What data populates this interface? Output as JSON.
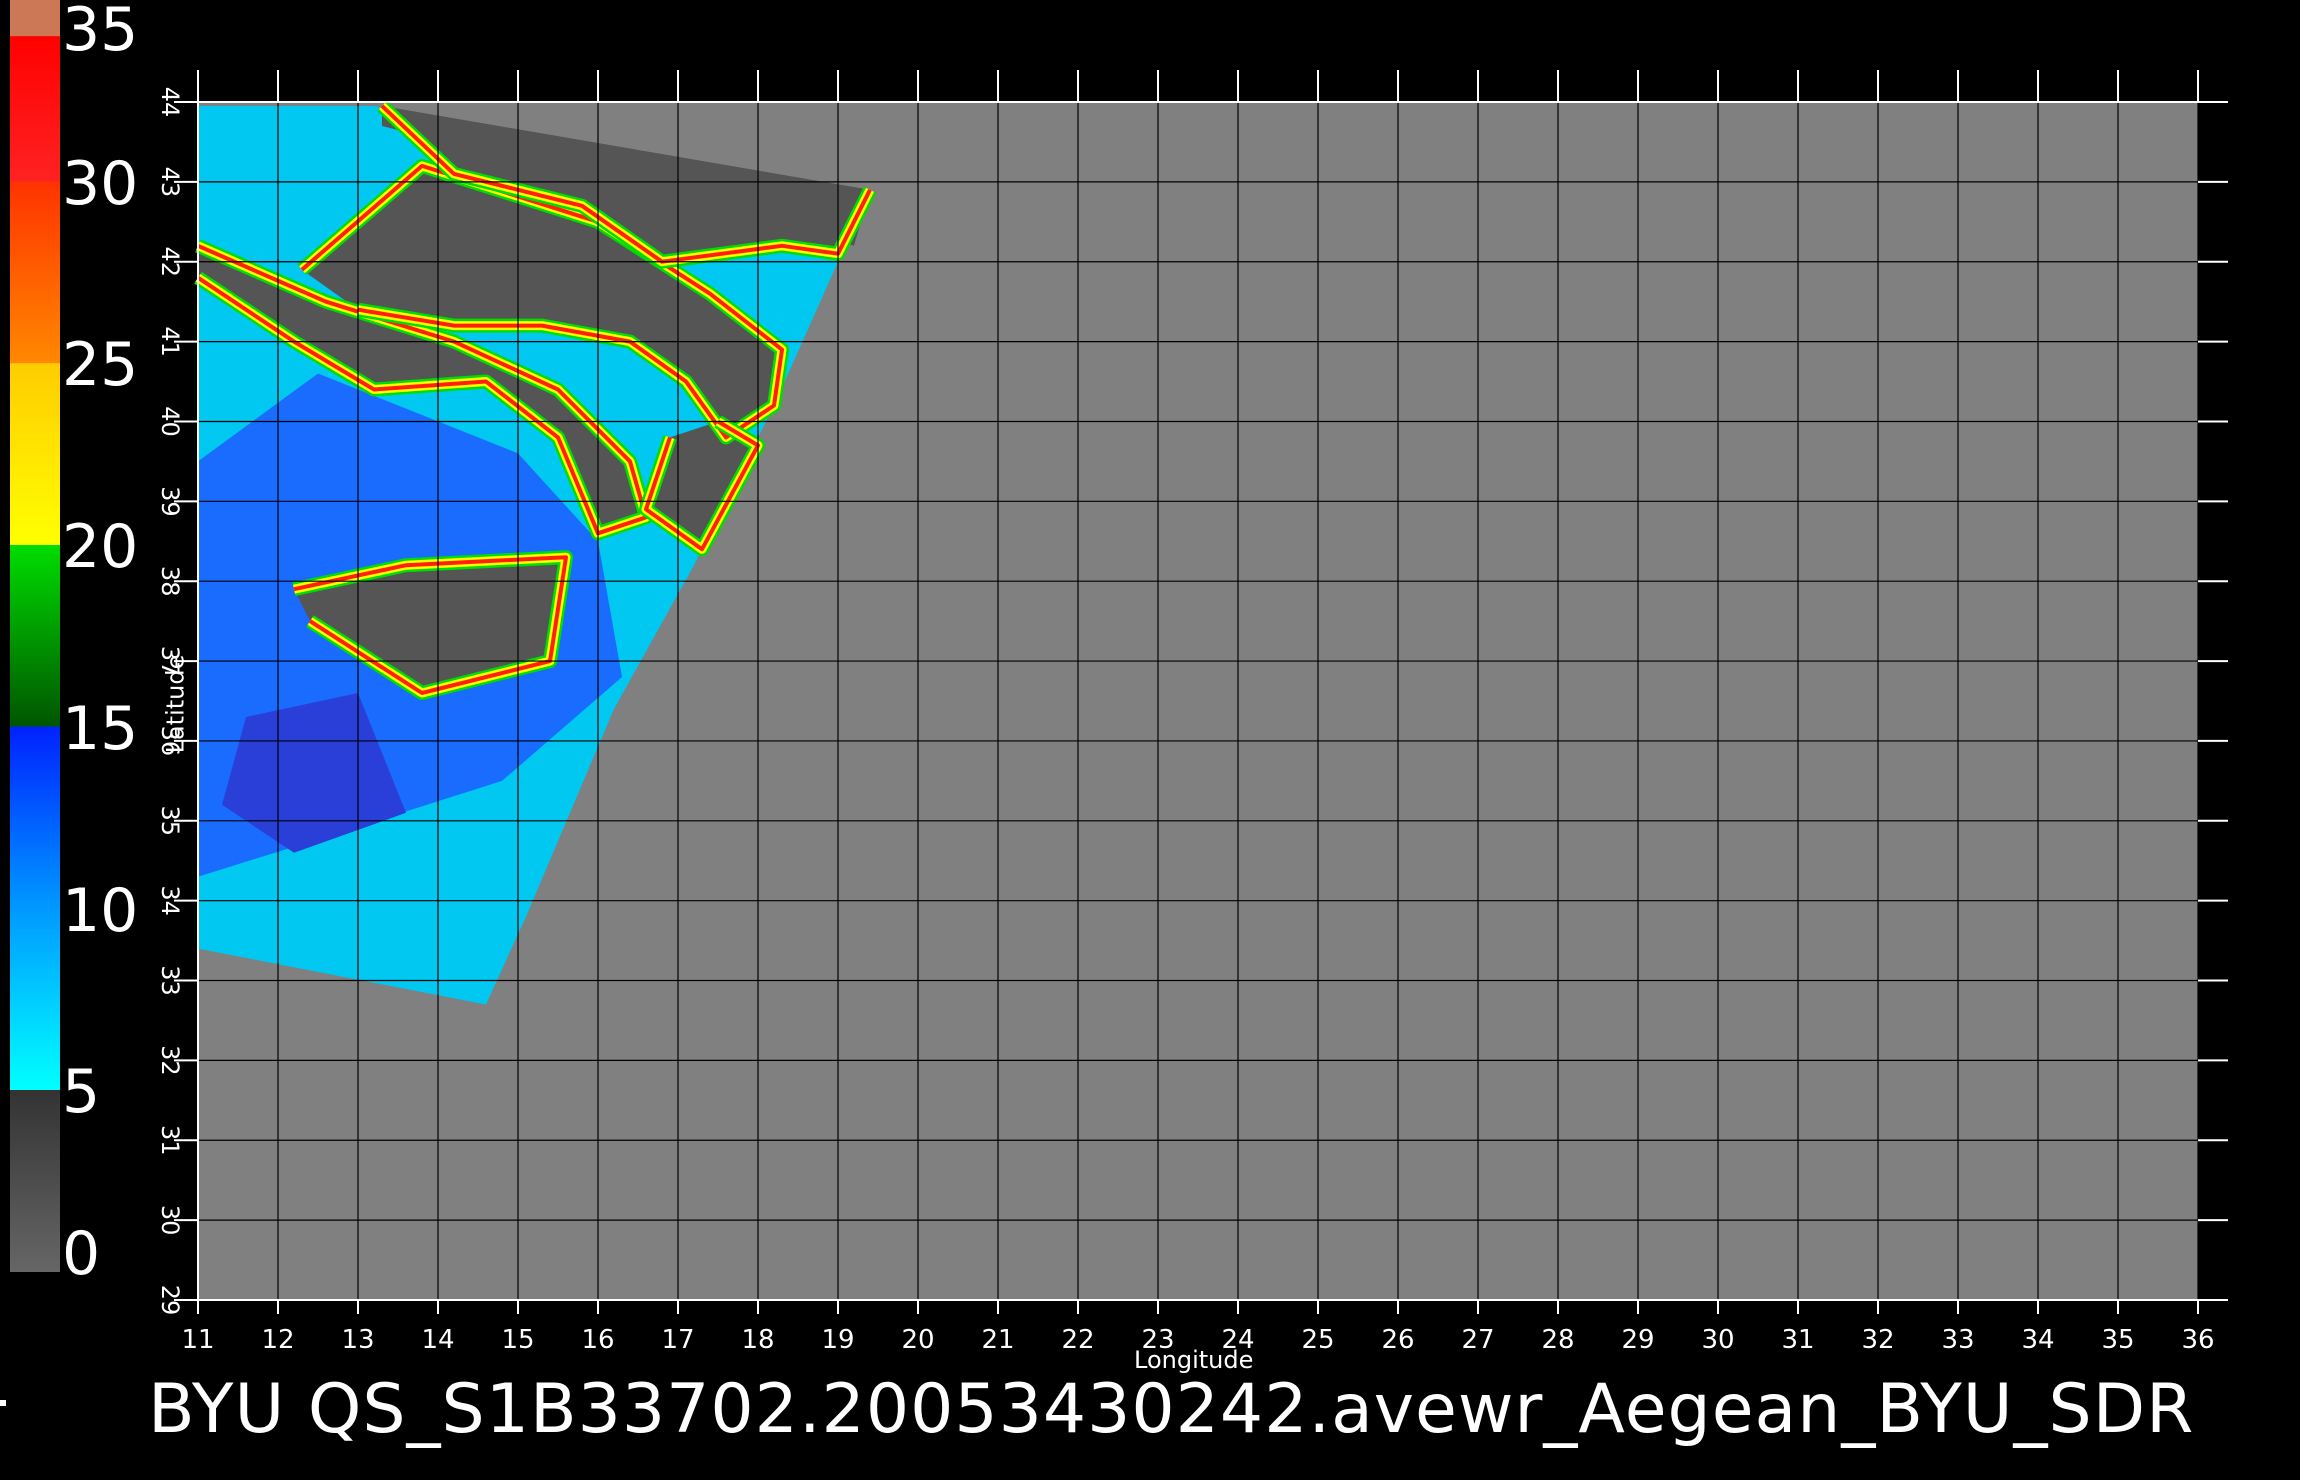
{
  "caption": "BYU QS_S1B33702.20053430242.avewr_Aegean_BYU_SDR",
  "axes": {
    "xlabel": "Longitude",
    "ylabel": "Latitude",
    "lon_ticks": [
      11,
      12,
      13,
      14,
      15,
      16,
      17,
      18,
      19,
      20,
      21,
      22,
      23,
      24,
      25,
      26,
      27,
      28,
      29,
      30,
      31,
      32,
      33,
      34,
      35,
      36
    ],
    "lat_ticks": [
      29,
      30,
      31,
      32,
      33,
      34,
      35,
      36,
      37,
      38,
      39,
      40,
      41,
      42,
      43,
      44
    ],
    "lon_range": [
      11,
      36
    ],
    "lat_range": [
      29,
      44
    ],
    "grid": true
  },
  "colorbar": {
    "labels": [
      "0",
      "5",
      "10",
      "15",
      "20",
      "25",
      "30",
      "35"
    ],
    "range": [
      0,
      35
    ],
    "stops": [
      {
        "value": 0,
        "color": "#666666"
      },
      {
        "value": 5,
        "color": "#333333"
      },
      {
        "value": 5.01,
        "color": "#00ffff"
      },
      {
        "value": 10,
        "color": "#0099ff"
      },
      {
        "value": 15,
        "color": "#0022ff"
      },
      {
        "value": 15.01,
        "color": "#005500"
      },
      {
        "value": 20,
        "color": "#00dd00"
      },
      {
        "value": 20.01,
        "color": "#ffff00"
      },
      {
        "value": 25,
        "color": "#ffcc00"
      },
      {
        "value": 25.01,
        "color": "#ff8800"
      },
      {
        "value": 30,
        "color": "#ff3300"
      },
      {
        "value": 30.01,
        "color": "#ff2222"
      },
      {
        "value": 34,
        "color": "#ff0000"
      },
      {
        "value": 34.01,
        "color": "#cc7755"
      },
      {
        "value": 35,
        "color": "#cc7755"
      }
    ]
  },
  "colors": {
    "background": "#000000",
    "map_background": "#808080",
    "land": "#555555",
    "grid": "#000000"
  }
}
